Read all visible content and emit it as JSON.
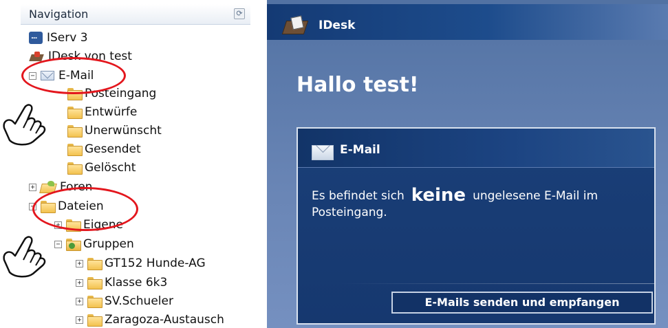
{
  "nav": {
    "title": "Navigation",
    "items": {
      "iserv": "IServ 3",
      "idesk": "IDesk von test",
      "email": "E-Mail",
      "inbox": "Posteingang",
      "drafts": "Entwürfe",
      "spam": "Unerwünscht",
      "sent": "Gesendet",
      "deleted": "Gelöscht",
      "forums": "Foren",
      "files": "Dateien",
      "own": "Eigene",
      "groups": "Gruppen",
      "group1": "GT152 Hunde-AG",
      "group2": "Klasse 6k3",
      "group3": "SV.Schueler",
      "group4": "Zaragoza-Austausch"
    }
  },
  "idesk": {
    "title": "IDesk",
    "greeting": "Hallo test!",
    "mail_box": {
      "title": "E-Mail",
      "message_prefix": "Es befindet sich",
      "message_emphasis": "keine",
      "message_suffix": "ungelesene E-Mail im Posteingang.",
      "button": "E-Mails senden und empfangen"
    }
  },
  "colors": {
    "annotation": "#e3161d",
    "idesk_background": "#5b7aab",
    "box_background": "#1a3f78"
  }
}
